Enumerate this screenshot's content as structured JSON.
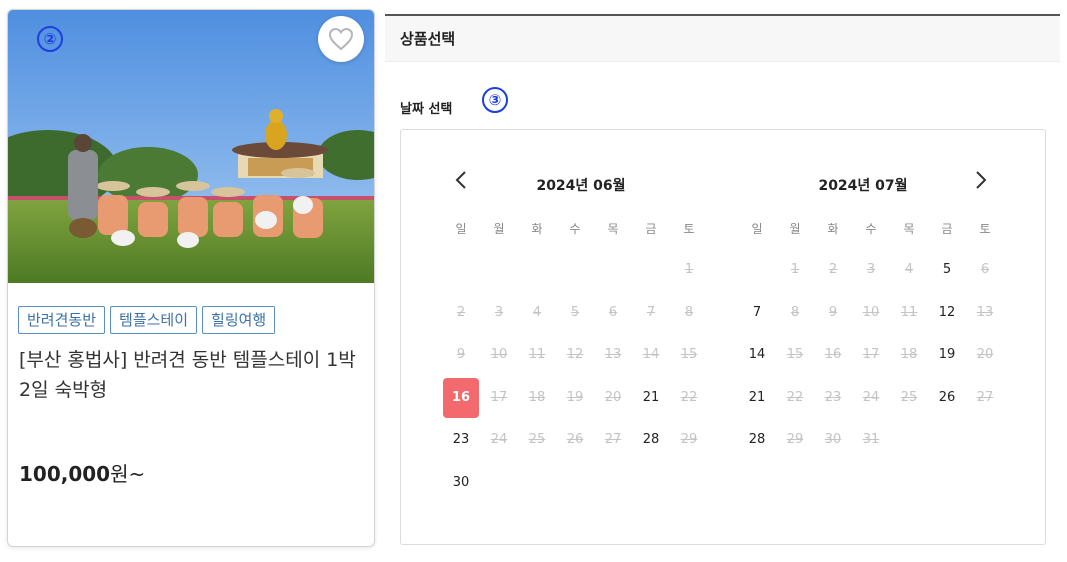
{
  "markers": {
    "card": "②",
    "date": "③"
  },
  "product": {
    "tags": [
      "반려견동반",
      "템플스테이",
      "힐링여행"
    ],
    "title": "[부산 홍법사] 반려견 동반 템플스테이 1박2일 숙박형",
    "price_num": "100,000",
    "price_suffix": "원~"
  },
  "section": {
    "header": "상품선택",
    "date_label": "날짜 선택"
  },
  "calendar": {
    "weekdays": [
      "일",
      "월",
      "화",
      "수",
      "목",
      "금",
      "토"
    ],
    "months": [
      {
        "title": "2024년 06월",
        "first_weekday": 6,
        "days": 30,
        "available": [
          16,
          21,
          23,
          28,
          30
        ],
        "selected": 16
      },
      {
        "title": "2024년 07월",
        "first_weekday": 1,
        "days": 31,
        "available": [
          5,
          7,
          12,
          14,
          19,
          21,
          26,
          28
        ],
        "selected": null
      }
    ]
  },
  "icons": {
    "heart": "heart-outline-icon",
    "prev": "chevron-left-icon",
    "next": "chevron-right-icon"
  },
  "colors": {
    "selected": "#f26a6e",
    "tag_border": "#5a8fc0",
    "marker": "#1c3fe0"
  }
}
